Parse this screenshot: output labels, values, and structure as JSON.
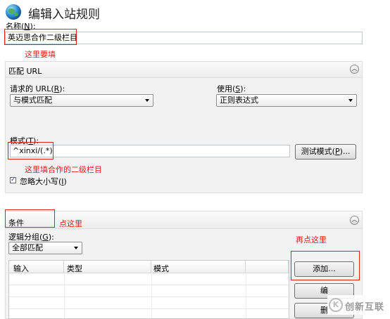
{
  "page": {
    "title": "编辑入站规则"
  },
  "name_field": {
    "label_prefix": "名称(",
    "label_key": "N",
    "label_suffix": "):",
    "value": "英迈思合作二级栏目"
  },
  "annotations": {
    "name_note": "这里要填",
    "pattern_note": "这里填合作的二级栏目",
    "conditions_note": "点这里",
    "add_note": "再点这里"
  },
  "match_url": {
    "header": "匹配 URL",
    "requested_url_label_prefix": "请求的 URL(",
    "requested_url_key": "R",
    "requested_url_label_suffix": "):",
    "requested_url_value": "与模式匹配",
    "using_label_prefix": "使用(",
    "using_key": "S",
    "using_label_suffix": "):",
    "using_value": "正则表达式",
    "pattern_label_prefix": "模式(",
    "pattern_key": "T",
    "pattern_label_suffix": "):",
    "pattern_value": "^xinxi/(.*)",
    "test_button_prefix": "测试模式(",
    "test_button_key": "P",
    "test_button_suffix": ")...",
    "ignore_case_prefix": "忽略大小写(",
    "ignore_case_key": "I",
    "ignore_case_suffix": ")",
    "ignore_case_checked": true
  },
  "conditions": {
    "header": "条件",
    "logical_group_prefix": "逻辑分组(",
    "logical_group_key": "G",
    "logical_group_suffix": "):",
    "logical_group_value": "全部匹配",
    "columns": [
      "输入",
      "类型",
      "模式"
    ],
    "add_button": "添加...",
    "edit_button": "编",
    "remove_button": "删"
  },
  "watermark": {
    "text": "创新互联"
  },
  "colors": {
    "accent_red": "#e02020",
    "section_bg": "#f2f2f2"
  }
}
